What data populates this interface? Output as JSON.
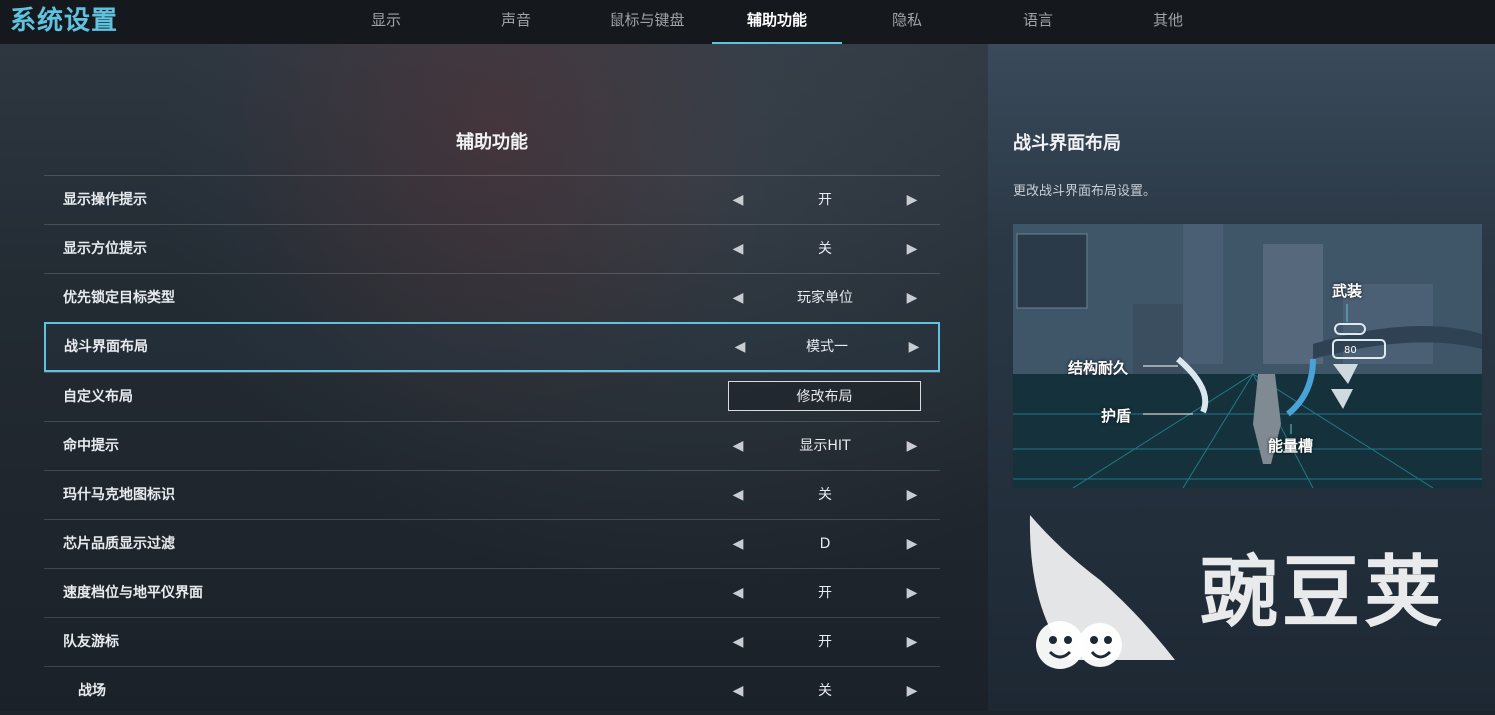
{
  "app": {
    "title": "系统设置"
  },
  "tabs": [
    {
      "label": "显示"
    },
    {
      "label": "声音"
    },
    {
      "label": "鼠标与键盘"
    },
    {
      "label": "辅助功能",
      "active": true
    },
    {
      "label": "隐私"
    },
    {
      "label": "语言"
    },
    {
      "label": "其他"
    }
  ],
  "section": {
    "title": "辅助功能"
  },
  "settings": [
    {
      "label": "显示操作提示",
      "value": "开"
    },
    {
      "label": "显示方位提示",
      "value": "关"
    },
    {
      "label": "优先锁定目标类型",
      "value": "玩家单位"
    },
    {
      "label": "战斗界面布局",
      "value": "模式一",
      "selected": true
    },
    {
      "label": "自定义布局",
      "button": "修改布局"
    },
    {
      "label": "命中提示",
      "value": "显示HIT"
    },
    {
      "label": "玛什马克地图标识",
      "value": "关"
    },
    {
      "label": "芯片品质显示过滤",
      "value": "D"
    },
    {
      "label": "速度档位与地平仪界面",
      "value": "开"
    },
    {
      "label": "队友游标",
      "value": "开"
    },
    {
      "label": "战场",
      "value": "关"
    }
  ],
  "arrows": {
    "left": "◀",
    "right": "▶"
  },
  "side": {
    "title": "战斗界面布局",
    "description": "更改战斗界面布局设置。",
    "preview_labels": {
      "armament": "武装",
      "structure": "结构耐久",
      "shield": "护盾",
      "energy": "能量槽",
      "ammo": "80"
    }
  },
  "watermark": {
    "text": "豌豆荚"
  },
  "colors": {
    "accent": "#5fc3df",
    "topbar": "#15191d"
  }
}
